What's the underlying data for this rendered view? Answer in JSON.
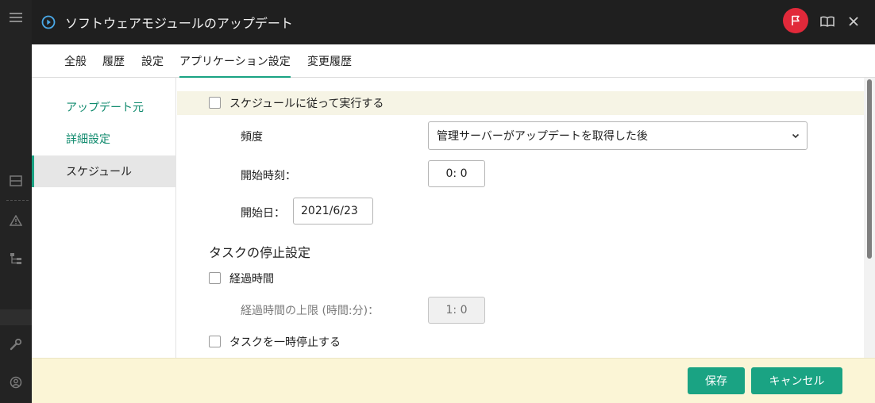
{
  "window": {
    "title": "ソフトウェアモジュールのアップデート"
  },
  "tabs": [
    {
      "label": "全般"
    },
    {
      "label": "履歴"
    },
    {
      "label": "設定"
    },
    {
      "label": "アプリケーション設定",
      "active": true
    },
    {
      "label": "変更履歴"
    }
  ],
  "sidebar": {
    "items": [
      {
        "label": "アップデート元"
      },
      {
        "label": "詳細設定"
      },
      {
        "label": "スケジュール",
        "active": true
      }
    ]
  },
  "schedule": {
    "run_by_schedule_label": "スケジュールに従って実行する",
    "run_by_schedule_checked": false,
    "frequency_label": "頻度",
    "frequency_value": "管理サーバーがアップデートを取得した後",
    "start_time_label": "開始時刻：",
    "start_time_value": "0:  0",
    "start_date_label": "開始日：",
    "start_date_value": "2021/6/23"
  },
  "stop": {
    "section_title": "タスクの停止設定",
    "elapsed_label": "経過時間",
    "elapsed_checked": false,
    "elapsed_limit_label": "経過時間の上限 (時間:分)：",
    "elapsed_limit_value": "1:  0",
    "pause_label": "タスクを一時停止する",
    "pause_checked": false
  },
  "footer": {
    "save_label": "保存",
    "cancel_label": "キャンセル"
  },
  "colors": {
    "accent": "#1aa383",
    "link": "#0f8a6d",
    "flag": "#e1293a",
    "footer_bg": "#fbf5d6",
    "titlebar": "#1f1f1f"
  },
  "icons": [
    "menu-icon",
    "play-circle-icon",
    "flag-icon",
    "book-icon",
    "close-icon",
    "chevron-down-icon",
    "list-icon",
    "warning-icon",
    "tree-icon",
    "wrench-icon",
    "user-icon"
  ]
}
